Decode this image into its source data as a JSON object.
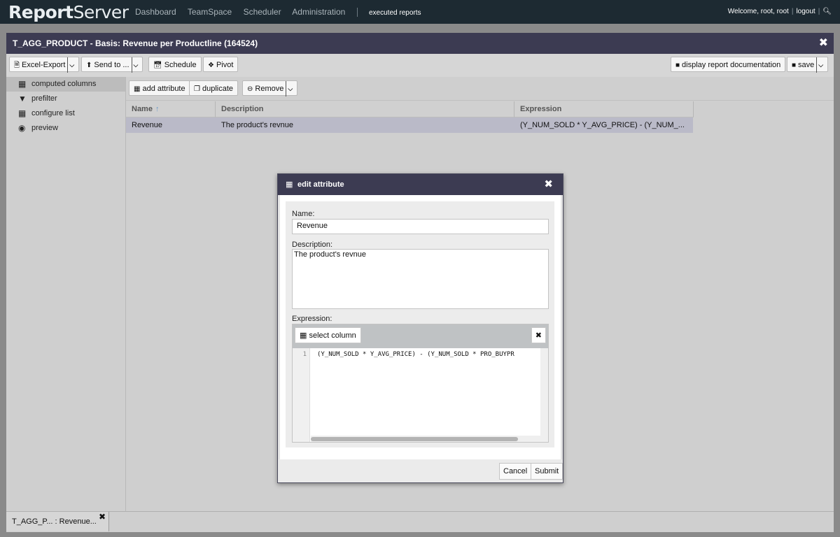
{
  "topbar": {
    "logo_a": "Report",
    "logo_b": "Server",
    "nav": [
      "Dashboard",
      "TeamSpace",
      "Scheduler",
      "Administration"
    ],
    "active": "executed reports",
    "welcome": "Welcome, root, root",
    "logout": "logout"
  },
  "window": {
    "title": "T_AGG_PRODUCT - Basis: Revenue per Productline (164524)",
    "toolbar": {
      "excel_export": "Excel-Export",
      "send_to": "Send to ...",
      "schedule": "Schedule",
      "pivot": "Pivot",
      "display_doc": "display report documentation",
      "save": "save"
    }
  },
  "sidebar": {
    "items": [
      {
        "label": "computed columns"
      },
      {
        "label": "prefilter"
      },
      {
        "label": "configure list"
      },
      {
        "label": "preview"
      }
    ]
  },
  "content": {
    "toolbar": {
      "add_attribute": "add attribute",
      "duplicate": "duplicate",
      "remove": "Remove"
    },
    "columns": [
      "Name",
      "Description",
      "Expression"
    ],
    "rows": [
      {
        "name": "Revenue",
        "description": "The product's revnue",
        "expression": "(Y_NUM_SOLD * Y_AVG_PRICE) - (Y_NUM_..."
      }
    ]
  },
  "bottom_tab": {
    "label": "T_AGG_P... : Revenue..."
  },
  "dialog": {
    "title": "edit attribute",
    "name_label": "Name:",
    "name_value": "Revenue",
    "description_label": "Description:",
    "description_value": "The product's revnue",
    "expression_label": "Expression:",
    "select_column": "select column",
    "line_number": "1",
    "code": "(Y_NUM_SOLD * Y_AVG_PRICE) - (Y_NUM_SOLD * PRO_BUYPR",
    "cancel": "Cancel",
    "submit": "Submit"
  }
}
